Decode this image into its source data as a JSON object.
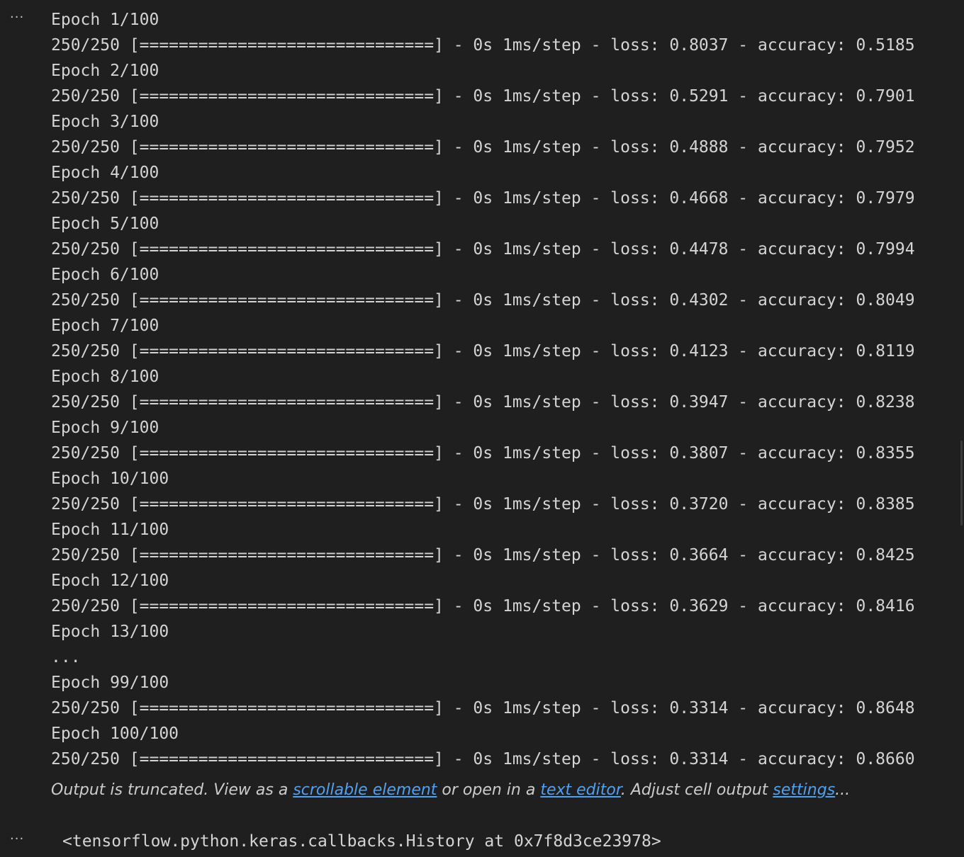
{
  "more_label": "···",
  "log_lines": [
    "Epoch 1/100",
    "250/250 [==============================] - 0s 1ms/step - loss: 0.8037 - accuracy: 0.5185",
    "Epoch 2/100",
    "250/250 [==============================] - 0s 1ms/step - loss: 0.5291 - accuracy: 0.7901",
    "Epoch 3/100",
    "250/250 [==============================] - 0s 1ms/step - loss: 0.4888 - accuracy: 0.7952",
    "Epoch 4/100",
    "250/250 [==============================] - 0s 1ms/step - loss: 0.4668 - accuracy: 0.7979",
    "Epoch 5/100",
    "250/250 [==============================] - 0s 1ms/step - loss: 0.4478 - accuracy: 0.7994",
    "Epoch 6/100",
    "250/250 [==============================] - 0s 1ms/step - loss: 0.4302 - accuracy: 0.8049",
    "Epoch 7/100",
    "250/250 [==============================] - 0s 1ms/step - loss: 0.4123 - accuracy: 0.8119",
    "Epoch 8/100",
    "250/250 [==============================] - 0s 1ms/step - loss: 0.3947 - accuracy: 0.8238",
    "Epoch 9/100",
    "250/250 [==============================] - 0s 1ms/step - loss: 0.3807 - accuracy: 0.8355",
    "Epoch 10/100",
    "250/250 [==============================] - 0s 1ms/step - loss: 0.3720 - accuracy: 0.8385",
    "Epoch 11/100",
    "250/250 [==============================] - 0s 1ms/step - loss: 0.3664 - accuracy: 0.8425",
    "Epoch 12/100",
    "250/250 [==============================] - 0s 1ms/step - loss: 0.3629 - accuracy: 0.8416",
    "Epoch 13/100",
    "...",
    "Epoch 99/100",
    "250/250 [==============================] - 0s 1ms/step - loss: 0.3314 - accuracy: 0.8648",
    "Epoch 100/100",
    "250/250 [==============================] - 0s 1ms/step - loss: 0.3314 - accuracy: 0.8660"
  ],
  "truncation": {
    "prefix": "Output is truncated. View as a ",
    "scrollable_link": "scrollable element",
    "middle": " or open in a ",
    "editor_link": "text editor",
    "after_editor": ". Adjust cell output ",
    "settings_link": "settings",
    "suffix": "..."
  },
  "result_text": "<tensorflow.python.keras.callbacks.History at 0x7f8d3ce23978>"
}
